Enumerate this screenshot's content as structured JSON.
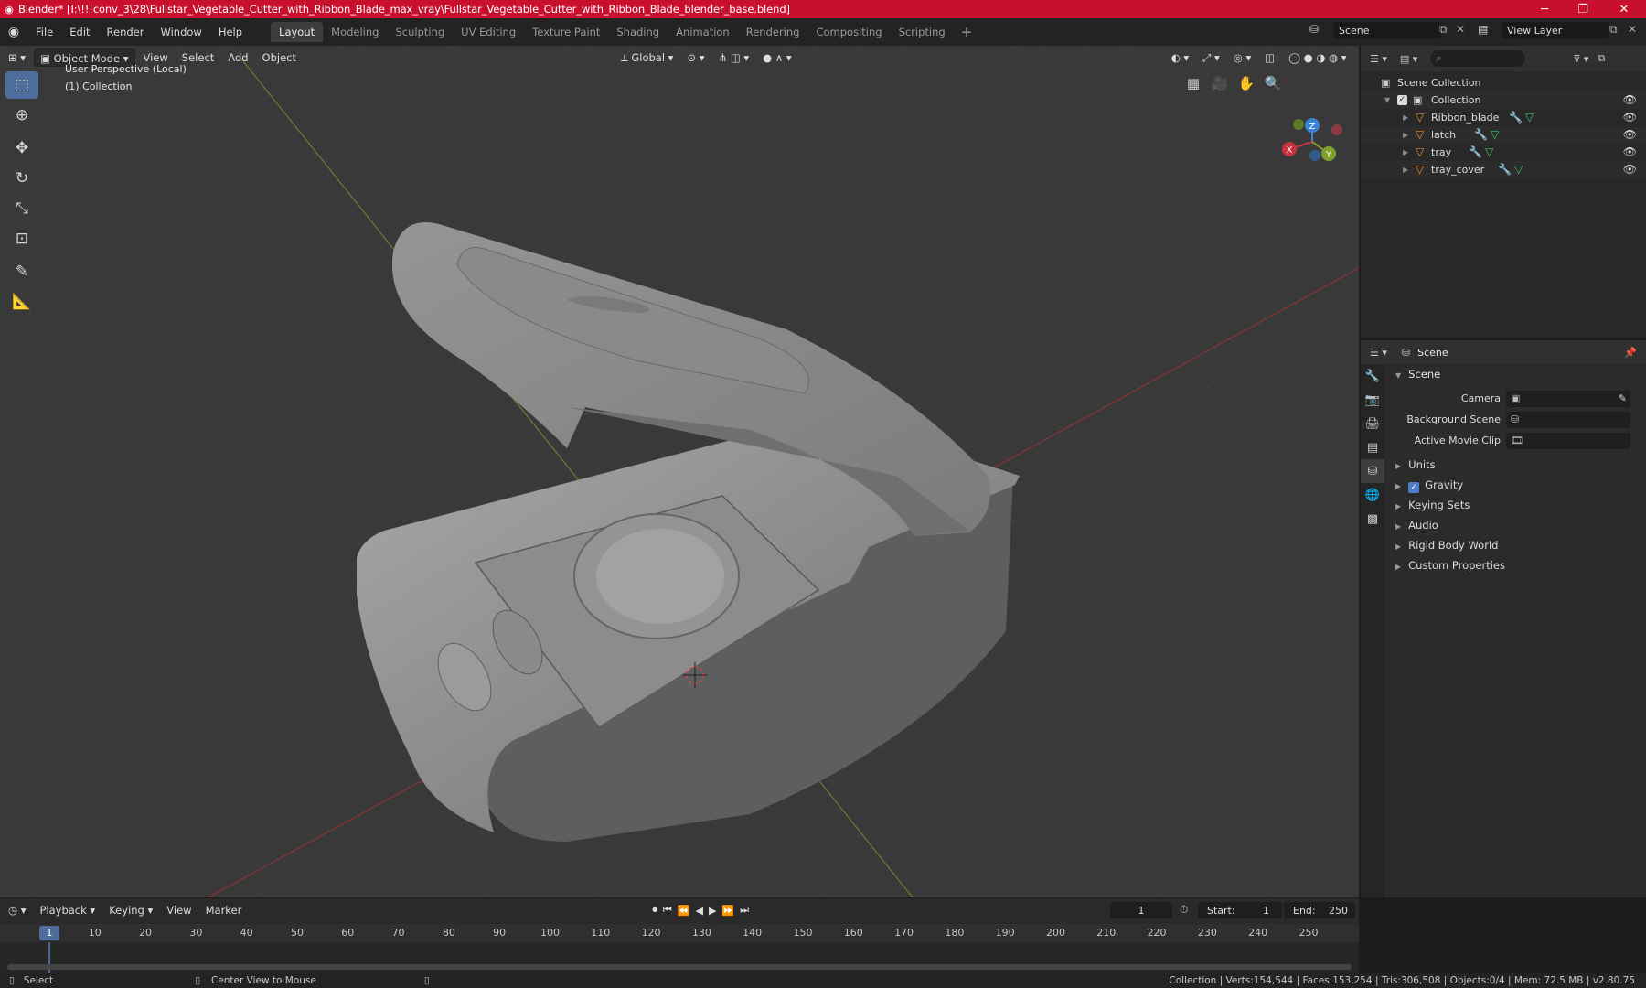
{
  "window": {
    "title": "Blender* [I:\\!!!conv_3\\28\\Fullstar_Vegetable_Cutter_with_Ribbon_Blade_max_vray\\Fullstar_Vegetable_Cutter_with_Ribbon_Blade_blender_base.blend]",
    "minimize": "─",
    "maximize": "❐",
    "close": "✕"
  },
  "menu": {
    "items": [
      "File",
      "Edit",
      "Render",
      "Window",
      "Help"
    ]
  },
  "workspaces": {
    "tabs": [
      "Layout",
      "Modeling",
      "Sculpting",
      "UV Editing",
      "Texture Paint",
      "Shading",
      "Animation",
      "Rendering",
      "Compositing",
      "Scripting"
    ],
    "active": "Layout",
    "add": "+"
  },
  "scene_selector": {
    "value": "Scene"
  },
  "view_layer_selector": {
    "value": "View Layer"
  },
  "viewport": {
    "mode": "Object Mode",
    "menus": [
      "View",
      "Select",
      "Add",
      "Object"
    ],
    "transform_orientation": "Global",
    "overlay_title": "User Perspective (Local)",
    "overlay_collection": "(1) Collection",
    "gizmo": {
      "x": "X",
      "y": "Y",
      "z": "Z"
    }
  },
  "outliner": {
    "scene_collection": "Scene Collection",
    "collection": "Collection",
    "objects": [
      "Ribbon_blade",
      "latch",
      "tray",
      "tray_cover"
    ]
  },
  "properties": {
    "header_title": "Scene",
    "section_title": "Scene",
    "fields": {
      "camera_label": "Camera",
      "background_scene_label": "Background Scene",
      "active_movie_clip_label": "Active Movie Clip"
    },
    "subsections": [
      "Units",
      "Gravity",
      "Keying Sets",
      "Audio",
      "Rigid Body World",
      "Custom Properties"
    ],
    "gravity_checked": true
  },
  "timeline": {
    "menus": [
      "Playback",
      "Keying",
      "View",
      "Marker"
    ],
    "current_frame": "1",
    "start_label": "Start:",
    "start_value": "1",
    "end_label": "End:",
    "end_value": "250",
    "ruler_ticks": [
      "1",
      "10",
      "20",
      "30",
      "40",
      "50",
      "60",
      "70",
      "80",
      "90",
      "100",
      "110",
      "120",
      "130",
      "140",
      "150",
      "160",
      "170",
      "180",
      "190",
      "200",
      "210",
      "220",
      "230",
      "240",
      "250"
    ]
  },
  "statusbar": {
    "select": "Select",
    "center_view": "Center View to Mouse",
    "stats": "Collection | Verts:154,544 | Faces:153,254 | Tris:306,508 | Objects:0/4 | Mem: 72.5 MB | v2.80.75"
  },
  "colors": {
    "title_bar": "#c8102e",
    "accent": "#4f6d9c",
    "viewport_bg": "#393939",
    "x_axis": "#c8313e",
    "y_axis": "#7fa02a",
    "z_axis": "#3b82d6"
  }
}
